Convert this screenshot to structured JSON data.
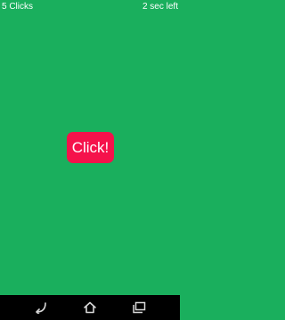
{
  "status": {
    "clicks": "5 Clicks",
    "time_left": "2 sec left"
  },
  "main": {
    "button_label": "Click!"
  },
  "colors": {
    "background": "#1aaf5d",
    "button": "#f5124b",
    "text": "#ffffff",
    "navbar": "#000000"
  },
  "navbar": {
    "icons": [
      "back-icon",
      "home-icon",
      "recents-icon"
    ]
  }
}
